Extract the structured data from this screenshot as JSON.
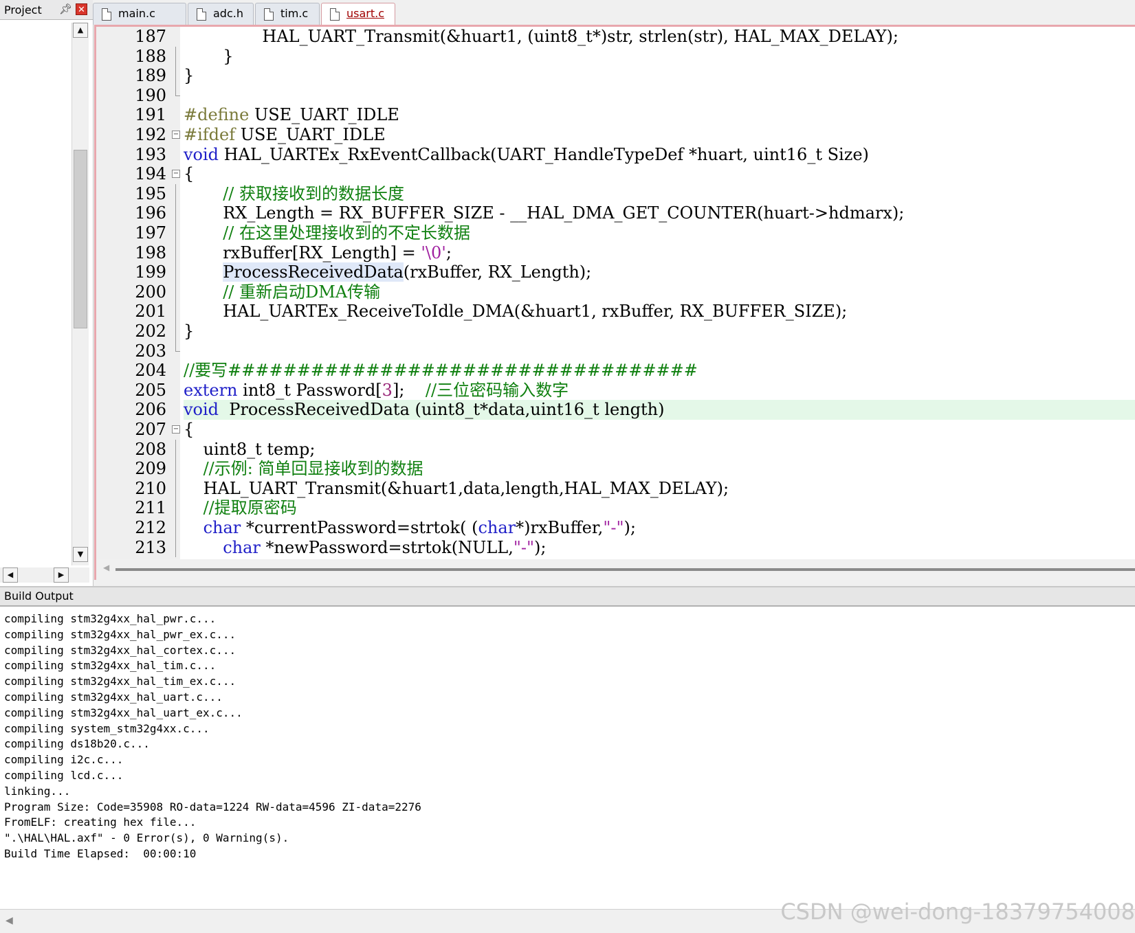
{
  "project_panel": {
    "title": "Project",
    "pin_icon": "pin-icon",
    "close_icon": "close-icon"
  },
  "tabs": [
    {
      "label": "main.c",
      "active": false
    },
    {
      "label": "adc.h",
      "active": false
    },
    {
      "label": "tim.c",
      "active": false
    },
    {
      "label": "usart.c",
      "active": true
    }
  ],
  "editor": {
    "lines": [
      {
        "n": "187",
        "indent": 8,
        "segs": [
          {
            "t": "HAL_UART_Transmit(&huart1, (uint8_t*)str, strlen(str), HAL_MAX_DELAY);"
          }
        ]
      },
      {
        "n": "188",
        "indent": 4,
        "segs": [
          {
            "t": "}"
          }
        ]
      },
      {
        "n": "189",
        "indent": 0,
        "segs": [
          {
            "t": "}"
          }
        ]
      },
      {
        "n": "190",
        "indent": 0,
        "segs": []
      },
      {
        "n": "191",
        "indent": 0,
        "segs": [
          {
            "t": "#define",
            "c": "pp"
          },
          {
            "t": " USE_UART_IDLE"
          }
        ]
      },
      {
        "n": "192",
        "indent": 0,
        "segs": [
          {
            "t": "#ifdef",
            "c": "pp"
          },
          {
            "t": " USE_UART_IDLE"
          }
        ]
      },
      {
        "n": "193",
        "indent": 0,
        "segs": [
          {
            "t": "void",
            "c": "kw"
          },
          {
            "t": " HAL_UARTEx_RxEventCallback(UART_HandleTypeDef *huart, uint16_t Size)"
          }
        ]
      },
      {
        "n": "194",
        "indent": 0,
        "segs": [
          {
            "t": "{"
          }
        ]
      },
      {
        "n": "195",
        "indent": 4,
        "segs": [
          {
            "t": "// 获取接收到的数据长度",
            "c": "cm"
          }
        ]
      },
      {
        "n": "196",
        "indent": 4,
        "segs": [
          {
            "t": "RX_Length = RX_BUFFER_SIZE - __HAL_DMA_GET_COUNTER(huart->hdmarx);"
          }
        ]
      },
      {
        "n": "197",
        "indent": 4,
        "segs": [
          {
            "t": "// 在这里处理接收到的不定长数据",
            "c": "cm"
          }
        ]
      },
      {
        "n": "198",
        "indent": 4,
        "segs": [
          {
            "t": "rxBuffer[RX_Length] = "
          },
          {
            "t": "'\\0'",
            "c": "str"
          },
          {
            "t": ";"
          }
        ]
      },
      {
        "n": "199",
        "indent": 4,
        "segs": [
          {
            "t": "ProcessReceivedData",
            "c": "fn-hl"
          },
          {
            "t": "(rxBuffer, RX_Length);"
          }
        ]
      },
      {
        "n": "200",
        "indent": 4,
        "segs": [
          {
            "t": "// 重新启动DMA传输",
            "c": "cm"
          }
        ]
      },
      {
        "n": "201",
        "indent": 4,
        "segs": [
          {
            "t": "HAL_UARTEx_ReceiveToIdle_DMA(&huart1, rxBuffer, RX_BUFFER_SIZE);"
          }
        ]
      },
      {
        "n": "202",
        "indent": 0,
        "segs": [
          {
            "t": "}"
          }
        ]
      },
      {
        "n": "203",
        "indent": 0,
        "segs": []
      },
      {
        "n": "204",
        "indent": 0,
        "segs": [
          {
            "t": "//要写##################################",
            "c": "cm"
          }
        ]
      },
      {
        "n": "205",
        "indent": 0,
        "segs": [
          {
            "t": "extern",
            "c": "kw"
          },
          {
            "t": " int8_t Password["
          },
          {
            "t": "3",
            "c": "num"
          },
          {
            "t": "];    "
          },
          {
            "t": "//三位密码输入数字",
            "c": "cm"
          }
        ]
      },
      {
        "n": "206",
        "indent": 0,
        "highlight": true,
        "segs": [
          {
            "t": "void",
            "c": "kw"
          },
          {
            "t": "  ProcessReceivedData (uint8_t*data,uint16_t length)"
          }
        ]
      },
      {
        "n": "207",
        "indent": 0,
        "segs": [
          {
            "t": "{"
          }
        ]
      },
      {
        "n": "208",
        "indent": 2,
        "segs": [
          {
            "t": "uint8_t temp;"
          }
        ]
      },
      {
        "n": "209",
        "indent": 2,
        "segs": [
          {
            "t": "//示例: 简单回显接收到的数据",
            "c": "cm"
          }
        ]
      },
      {
        "n": "210",
        "indent": 2,
        "segs": [
          {
            "t": "HAL_UART_Transmit(&huart1,data,length,HAL_MAX_DELAY);"
          }
        ]
      },
      {
        "n": "211",
        "indent": 2,
        "segs": [
          {
            "t": "//提取原密码",
            "c": "cm"
          }
        ]
      },
      {
        "n": "212",
        "indent": 2,
        "segs": [
          {
            "t": "char",
            "c": "kw"
          },
          {
            "t": " *currentPassword=strtok( ("
          },
          {
            "t": "char",
            "c": "kw"
          },
          {
            "t": "*)rxBuffer,"
          },
          {
            "t": "\"-\"",
            "c": "str"
          },
          {
            "t": ");"
          }
        ]
      },
      {
        "n": "213",
        "indent": 4,
        "segs": [
          {
            "t": "char",
            "c": "kw"
          },
          {
            "t": " *newPassword=strtok(NULL,"
          },
          {
            "t": "\"-\"",
            "c": "str"
          },
          {
            "t": ");"
          }
        ]
      }
    ]
  },
  "build_output": {
    "title": "Build Output",
    "lines": [
      "compiling stm32g4xx_hal_pwr.c...",
      "compiling stm32g4xx_hal_pwr_ex.c...",
      "compiling stm32g4xx_hal_cortex.c...",
      "compiling stm32g4xx_hal_tim.c...",
      "compiling stm32g4xx_hal_tim_ex.c...",
      "compiling stm32g4xx_hal_uart.c...",
      "compiling stm32g4xx_hal_uart_ex.c...",
      "compiling system_stm32g4xx.c...",
      "compiling ds18b20.c...",
      "compiling i2c.c...",
      "compiling lcd.c...",
      "linking...",
      "Program Size: Code=35908 RO-data=1224 RW-data=4596 ZI-data=2276",
      "FromELF: creating hex file...",
      "\".\\HAL\\HAL.axf\" - 0 Error(s), 0 Warning(s).",
      "Build Time Elapsed:  00:00:10"
    ]
  },
  "watermark": "CSDN @wei-dong-18379754008",
  "colors": {
    "keyword": "#2020c8",
    "comment": "#108010",
    "string": "#a020a0",
    "line_highlight": "#e4f8e8",
    "active_tab_border": "#e8a7ad"
  }
}
